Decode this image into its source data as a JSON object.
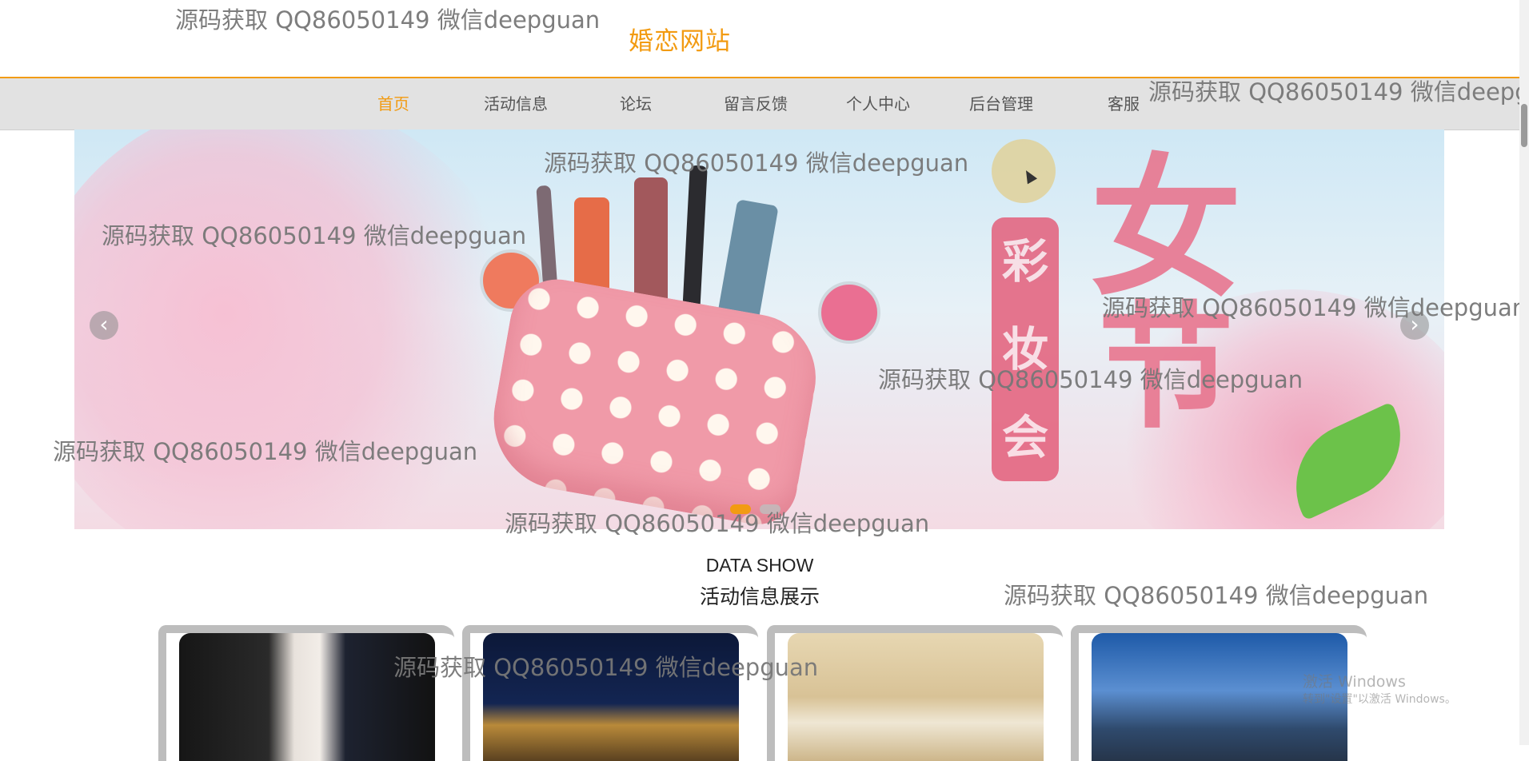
{
  "header": {
    "site_title": "婚恋网站"
  },
  "nav": {
    "items": [
      {
        "label": "首页",
        "active": true
      },
      {
        "label": "活动信息",
        "active": false
      },
      {
        "label": "论坛",
        "active": false
      },
      {
        "label": "留言反馈",
        "active": false
      },
      {
        "label": "个人中心",
        "active": false
      },
      {
        "label": "后台管理",
        "active": false
      },
      {
        "label": "客服",
        "active": false
      }
    ]
  },
  "banner": {
    "prev_arrow": "‹",
    "next_arrow": "›",
    "calligraphy": [
      "女",
      "节",
      "彩",
      "妆",
      "会"
    ],
    "slides_total": 2,
    "active_slide": 1
  },
  "section": {
    "title_en": "DATA SHOW",
    "title_cn": "活动信息展示"
  },
  "watermark": {
    "text": "源码获取 QQ86050149 微信deepguan"
  },
  "os_overlay": {
    "activate_title": "激活 Windows",
    "activate_sub": "转到\"设置\"以激活 Windows。"
  },
  "colors": {
    "accent": "#f29b12",
    "nav_bg": "#e2e2e2",
    "card_border": "#bdbdbd"
  }
}
